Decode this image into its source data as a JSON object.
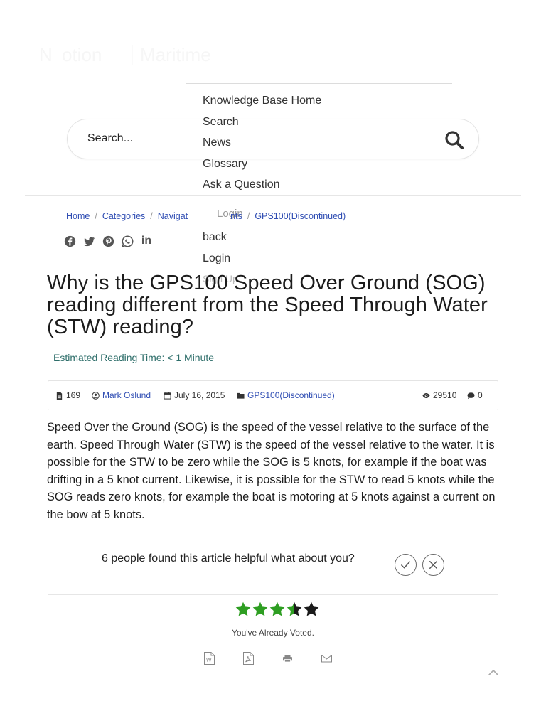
{
  "search": {
    "placeholder": "Search..."
  },
  "menu": {
    "items": [
      "Knowledge Base Home",
      "Search",
      "News",
      "Glossary",
      "Ask a Question"
    ],
    "login_muted": "Login",
    "back": "back",
    "login": "Login",
    "signup": "Sign Up"
  },
  "breadcrumb": {
    "home": "Home",
    "categories": "Categories",
    "navigat_fragment": "Navigat",
    "nts_fragment": "nts",
    "current": "GPS100(Discontinued)"
  },
  "social": {
    "linkedin_label": "in"
  },
  "article": {
    "title": "Why is the GPS100 Speed Over Ground (SOG) reading different from the Speed Through Water (STW) reading?",
    "reading_time": "Estimated Reading Time: < 1 Minute",
    "meta": {
      "id": "169",
      "author": "Mark Oslund",
      "date": "July 16, 2015",
      "category": "GPS100(Discontinued)",
      "views": "29510",
      "comments": "0"
    },
    "body": "Speed Over the Ground (SOG) is the speed of the vessel relative to the surface of the earth. Speed Through Water (STW) is the speed of the vessel relative to the water. It is possible for the STW to be zero while the SOG is 5 knots, for example if the boat was drifting in a 5 knot current. Likewise, it is possible for the STW to read 5 knots while the SOG reads zero knots, for example the boat is motoring at 5 knots against a current on the bow at 5 knots."
  },
  "feedback": {
    "helpful_text": "6 people found this article helpful what about you?"
  },
  "rating": {
    "value": 3.5,
    "max": 5,
    "voted_text": "You've Already Voted."
  },
  "colors": {
    "link": "#2f4db3",
    "star_filled": "#2e9e22",
    "star_empty": "#1a1a1a",
    "reading_time": "#2e6e6a"
  }
}
